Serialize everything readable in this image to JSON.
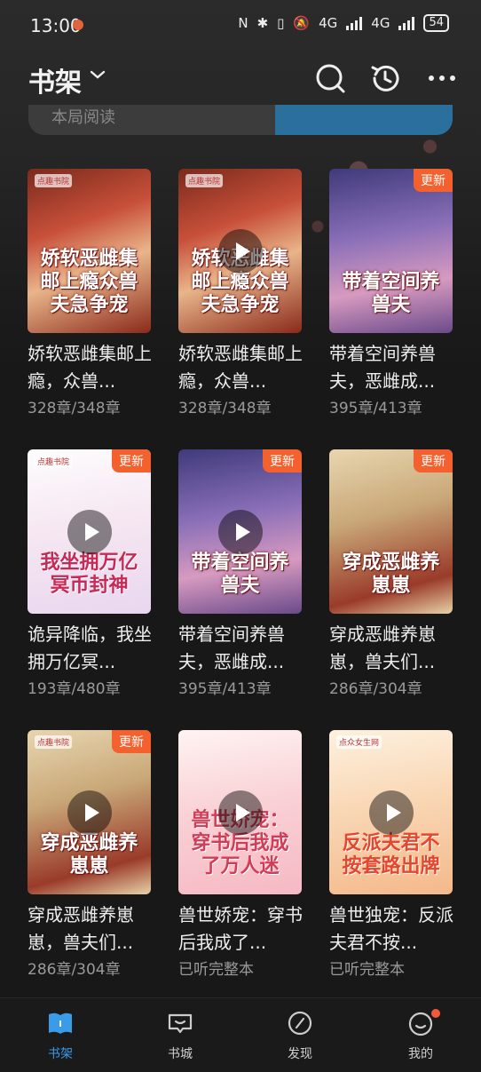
{
  "status": {
    "time": "13:00",
    "net1": "4G",
    "net2": "4G",
    "battery": "54"
  },
  "header": {
    "title": "书架",
    "search_peek_text": "本局阅读"
  },
  "books": [
    {
      "name": "娇软恶雌集邮上瘾，众兽...",
      "progress": "328章/348章",
      "cover_title": "娇软恶雌集邮上瘾众兽夫急争宠",
      "badge": "",
      "has_play": false,
      "brand": "点趣书院"
    },
    {
      "name": "娇软恶雌集邮上瘾，众兽...",
      "progress": "328章/348章",
      "cover_title": "娇软恶雌集邮上瘾众兽夫急争宠",
      "badge": "",
      "has_play": true,
      "brand": "点趣书院"
    },
    {
      "name": "带着空间养兽夫，恶雌成...",
      "progress": "395章/413章",
      "cover_title": "带着空间养兽夫",
      "badge": "更新",
      "has_play": false,
      "brand": ""
    },
    {
      "name": "诡异降临，我坐拥万亿冥...",
      "progress": "193章/480章",
      "cover_title": "我坐拥万亿冥币封神",
      "badge": "更新",
      "has_play": true,
      "brand": "点趣书院"
    },
    {
      "name": "带着空间养兽夫，恶雌成...",
      "progress": "395章/413章",
      "cover_title": "带着空间养兽夫",
      "badge": "更新",
      "has_play": true,
      "brand": ""
    },
    {
      "name": "穿成恶雌养崽崽，兽夫们...",
      "progress": "286章/304章",
      "cover_title": "穿成恶雌养崽崽",
      "badge": "更新",
      "has_play": false,
      "brand": ""
    },
    {
      "name": "穿成恶雌养崽崽，兽夫们...",
      "progress": "286章/304章",
      "cover_title": "穿成恶雌养崽崽",
      "badge": "更新",
      "has_play": true,
      "brand": "点趣书院"
    },
    {
      "name": "兽世娇宠：穿书后我成了...",
      "progress": "已听完整本",
      "cover_title": "兽世娇宠：穿书后我成了万人迷",
      "badge": "",
      "has_play": true,
      "brand": ""
    },
    {
      "name": "兽世独宠：反派夫君不按...",
      "progress": "已听完整本",
      "cover_title": "反派夫君不按套路出牌",
      "badge": "",
      "has_play": true,
      "brand": "点众女生网"
    }
  ],
  "nav": [
    {
      "label": "书架",
      "icon": "bookshelf-icon"
    },
    {
      "label": "书城",
      "icon": "bookstore-icon"
    },
    {
      "label": "发现",
      "icon": "discover-icon"
    },
    {
      "label": "我的",
      "icon": "profile-icon"
    }
  ],
  "colors": {
    "accent": "#3a9be8",
    "badge": "#f2612e"
  }
}
